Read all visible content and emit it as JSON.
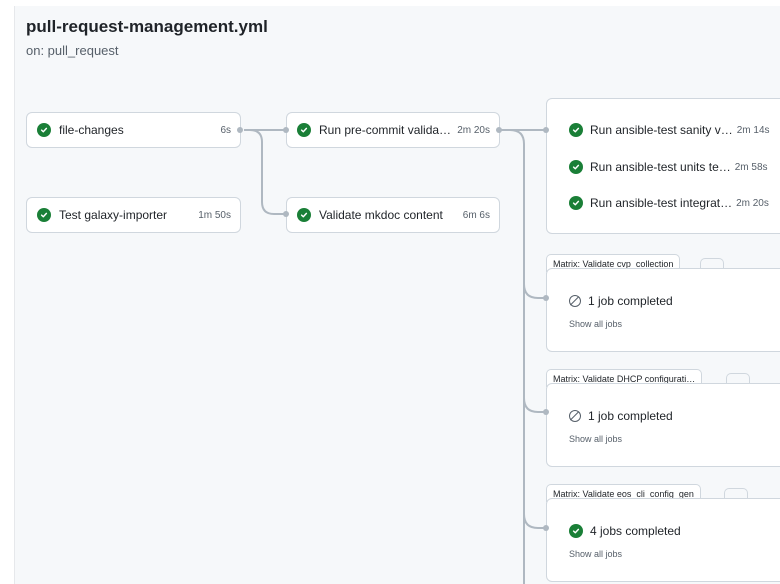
{
  "workflow": {
    "title": "pull-request-management.yml",
    "trigger": "on: pull_request"
  },
  "jobs": [
    {
      "name": "file-changes",
      "duration": "6s",
      "status": "success"
    },
    {
      "name": "Test galaxy-importer",
      "duration": "1m 50s",
      "status": "success"
    },
    {
      "name": "Run pre-commit validati…",
      "duration": "2m 20s",
      "status": "success"
    },
    {
      "name": "Validate mkdoc content",
      "duration": "6m 6s",
      "status": "success"
    }
  ],
  "ansible_group": [
    {
      "name": "Run ansible-test sanity v…",
      "duration": "2m 14s",
      "status": "success"
    },
    {
      "name": "Run ansible-test units te…",
      "duration": "2m 58s",
      "status": "success"
    },
    {
      "name": "Run ansible-test integrat…",
      "duration": "2m 20s",
      "status": "success"
    }
  ],
  "matrices": [
    {
      "title": "Matrix: Validate cvp_collection",
      "summary": "1 job completed",
      "status": "skipped",
      "link": "Show all jobs"
    },
    {
      "title": "Matrix: Validate DHCP configurati…",
      "summary": "1 job completed",
      "status": "skipped",
      "link": "Show all jobs"
    },
    {
      "title": "Matrix: Validate eos_cli_config_gen",
      "summary": "4 jobs completed",
      "status": "success",
      "link": "Show all jobs"
    }
  ],
  "colors": {
    "success": "#1a7f37",
    "border": "#d0d7de",
    "connector": "#afb8c1",
    "canvas": "#f6f8fa"
  },
  "icons": {
    "success": "check-circle-icon",
    "skipped": "skip-icon"
  }
}
